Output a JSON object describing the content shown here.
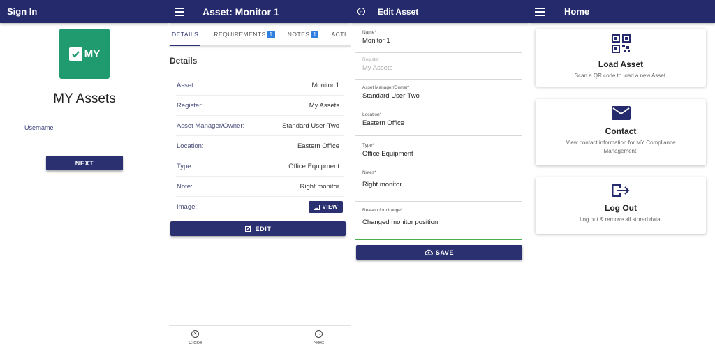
{
  "signin": {
    "title": "Sign In",
    "logo_text": "MY",
    "app_name": "MY Assets",
    "username_label": "Username",
    "next_label": "NEXT"
  },
  "asset_view": {
    "title": "Asset: Monitor 1",
    "tabs": [
      {
        "label": "DETAILS",
        "badge": ""
      },
      {
        "label": "REQUIREMENTS",
        "badge": "1"
      },
      {
        "label": "NOTES",
        "badge": "1"
      },
      {
        "label": "ACTI",
        "badge": ""
      }
    ],
    "section_title": "Details",
    "rows": [
      {
        "label": "Asset:",
        "value": "Monitor 1"
      },
      {
        "label": "Register:",
        "value": "My Assets"
      },
      {
        "label": "Asset Manager/Owner:",
        "value": "Standard User-Two"
      },
      {
        "label": "Location:",
        "value": "Eastern Office"
      },
      {
        "label": "Type:",
        "value": "Office Equipment"
      },
      {
        "label": "Note:",
        "value": "Right monitor"
      },
      {
        "label": "Image:",
        "value": ""
      }
    ],
    "view_label": "VIEW",
    "edit_label": "EDIT",
    "nav": {
      "close": "Close",
      "next": "Next"
    }
  },
  "edit_asset": {
    "title": "Edit Asset",
    "fields": [
      {
        "label": "Name*",
        "value": "Monitor 1"
      },
      {
        "label": "Register",
        "value": "My Assets"
      },
      {
        "label": "Asset Manager/Owner*",
        "value": "Standard User-Two"
      },
      {
        "label": "Location*",
        "value": "Eastern Office"
      },
      {
        "label": "Type*",
        "value": "Office Equipment"
      },
      {
        "label": "Notes*",
        "value": "Right monitor"
      },
      {
        "label": "Reason for change*",
        "value": "Changed monitor position"
      }
    ],
    "save_label": "SAVE"
  },
  "home": {
    "title": "Home",
    "cards": [
      {
        "title": "Load Asset",
        "desc": "Scan a QR code to load a new Asset.",
        "icon": "qr-code-icon"
      },
      {
        "title": "Contact",
        "desc": "View contact information for MY Compliance Management.",
        "icon": "mail-icon"
      },
      {
        "title": "Log Out",
        "desc": "Log out & remove all stored data.",
        "icon": "logout-icon"
      }
    ]
  },
  "colors": {
    "primary": "#242a6b",
    "logo_green": "#1f9b6f",
    "badge": "#2f7fe0",
    "focus": "#4caf50"
  }
}
